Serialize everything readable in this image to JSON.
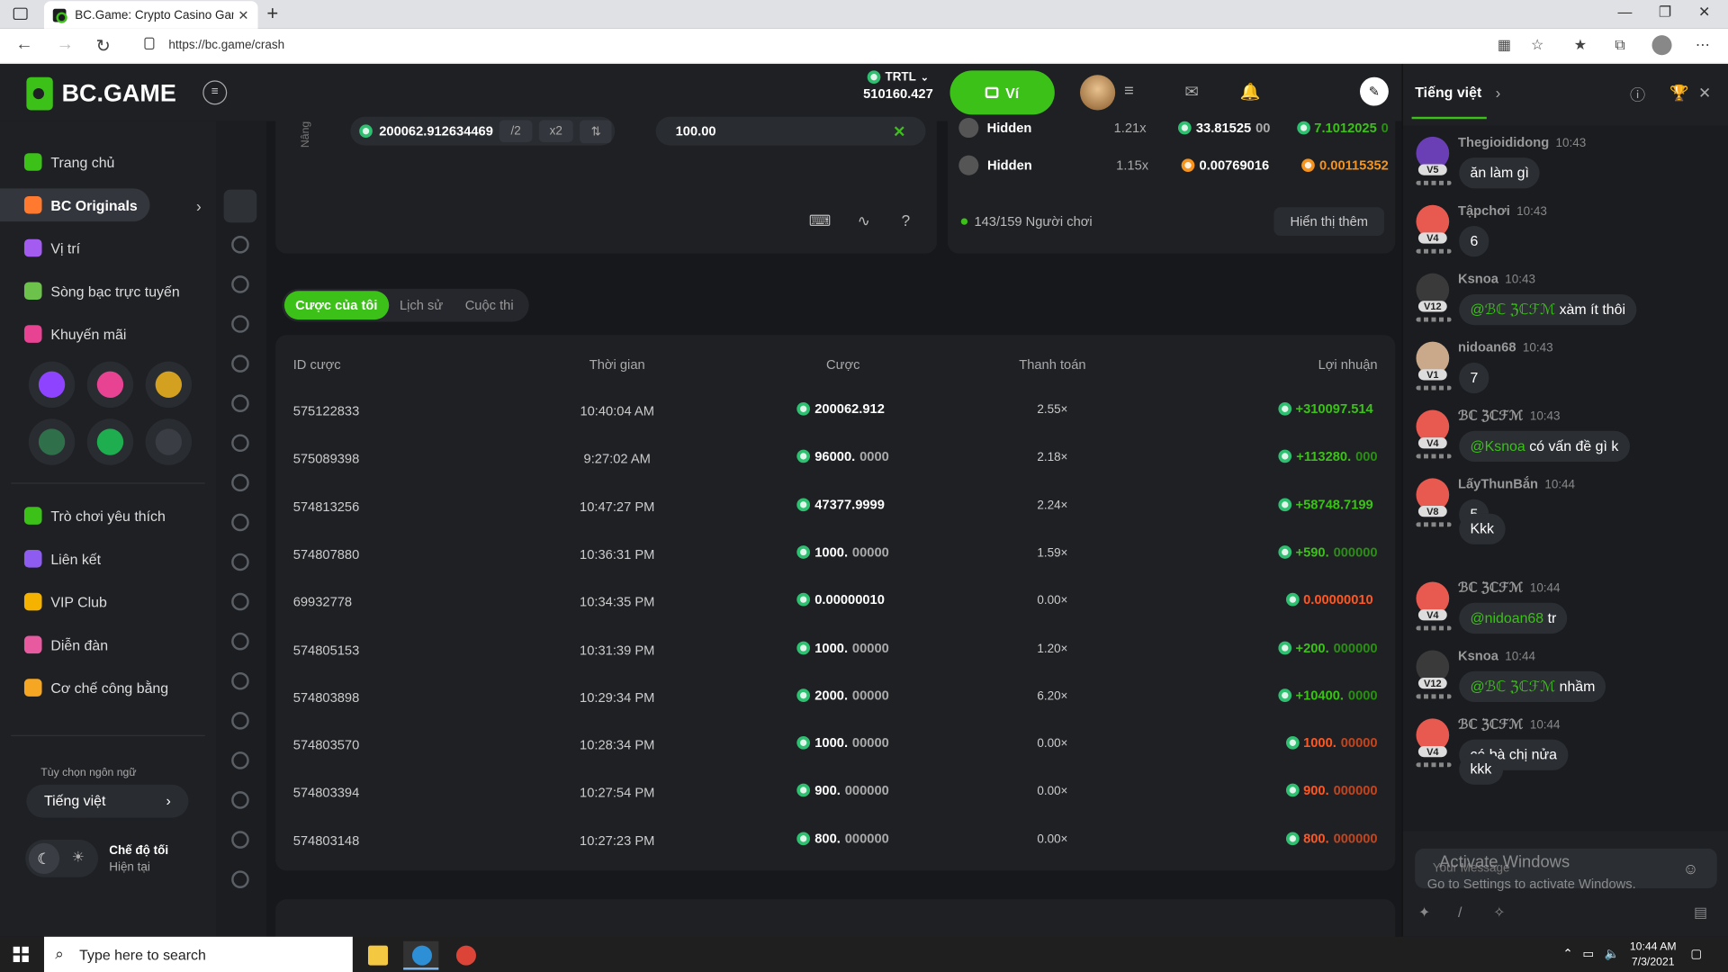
{
  "browser": {
    "tab_title": "BC.Game: Crypto Casino Games",
    "url": "https://bc.game/crash"
  },
  "header": {
    "logo": "BC.GAME",
    "currency": "TRTL",
    "balance": "510160.427",
    "wallet_label": "Ví"
  },
  "sidebar": {
    "items": [
      {
        "label": "Trang chủ",
        "color": "#3bc117"
      },
      {
        "label": "BC Originals",
        "color": "#ff7a2f"
      },
      {
        "label": "Vị trí",
        "color": "#a45cf0"
      },
      {
        "label": "Sòng bạc trực tuyến",
        "color": "#6cc24a"
      },
      {
        "label": "Khuyến mãi",
        "color": "#e84393"
      },
      {
        "label": "Trò chơi yêu thích",
        "color": "#3bc117"
      },
      {
        "label": "Liên kết",
        "color": "#8e5cf0"
      },
      {
        "label": "VIP Club",
        "color": "#f5b300"
      },
      {
        "label": "Diễn đàn",
        "color": "#e85aa0"
      },
      {
        "label": "Cơ chế công bằng",
        "color": "#f5a623"
      }
    ],
    "language_label": "Tùy chọn ngôn ngữ",
    "language_value": "Tiếng việt",
    "dark_mode_label": "Chế độ tối",
    "dark_mode_sub": "Hiện tại"
  },
  "game_panel": {
    "side_label": "Nâng",
    "amount": "200062.912634469",
    "half": "/2",
    "double": "x2",
    "cashout": "100.00"
  },
  "live_bets": {
    "rows": [
      {
        "name": "Hidden",
        "mult": "1.21x",
        "bet": "33.81525",
        "bet_dec": "00",
        "win": "7.1012025",
        "win_dec": "0"
      },
      {
        "name": "Hidden",
        "mult": "1.15x",
        "bet": "0.00769016",
        "win": "0.00115352"
      }
    ],
    "players": "143/159 Người chơi",
    "more": "Hiển thị thêm"
  },
  "bets_tabs": [
    "Cược của tôi",
    "Lịch sử",
    "Cuộc thi"
  ],
  "bets_table": {
    "headers": [
      "ID cược",
      "Thời gian",
      "Cược",
      "Thanh toán",
      "Lợi nhuận"
    ],
    "rows": [
      {
        "id": "575122833",
        "time": "10:40:04 AM",
        "bet": "200062.912",
        "bet_dec": "",
        "payout": "2.55×",
        "profit": "+310097.514",
        "profit_dec": "",
        "win": true
      },
      {
        "id": "575089398",
        "time": "9:27:02 AM",
        "bet": "96000.",
        "bet_dec": "0000",
        "payout": "2.18×",
        "profit": "+113280.",
        "profit_dec": "000",
        "win": true
      },
      {
        "id": "574813256",
        "time": "10:47:27 PM",
        "bet": "47377.9999",
        "bet_dec": "",
        "payout": "2.24×",
        "profit": "+58748.7199",
        "profit_dec": "",
        "win": true
      },
      {
        "id": "574807880",
        "time": "10:36:31 PM",
        "bet": "1000.",
        "bet_dec": "00000",
        "payout": "1.59×",
        "profit": "+590.",
        "profit_dec": "000000",
        "win": true
      },
      {
        "id": "69932778",
        "time": "10:34:35 PM",
        "bet": "0.00000010",
        "bet_dec": "",
        "payout": "0.00×",
        "profit": "0.00000010",
        "profit_dec": "",
        "win": false
      },
      {
        "id": "574805153",
        "time": "10:31:39 PM",
        "bet": "1000.",
        "bet_dec": "00000",
        "payout": "1.20×",
        "profit": "+200.",
        "profit_dec": "000000",
        "win": true
      },
      {
        "id": "574803898",
        "time": "10:29:34 PM",
        "bet": "2000.",
        "bet_dec": "00000",
        "payout": "6.20×",
        "profit": "+10400.",
        "profit_dec": "0000",
        "win": true
      },
      {
        "id": "574803570",
        "time": "10:28:34 PM",
        "bet": "1000.",
        "bet_dec": "00000",
        "payout": "0.00×",
        "profit": "1000.",
        "profit_dec": "00000",
        "win": false
      },
      {
        "id": "574803394",
        "time": "10:27:54 PM",
        "bet": "900.",
        "bet_dec": "000000",
        "payout": "0.00×",
        "profit": "900.",
        "profit_dec": "000000",
        "win": false
      },
      {
        "id": "574803148",
        "time": "10:27:23 PM",
        "bet": "800.",
        "bet_dec": "000000",
        "payout": "0.00×",
        "profit": "800.",
        "profit_dec": "000000",
        "win": false
      }
    ]
  },
  "chat": {
    "language": "Tiếng việt",
    "messages": [
      {
        "name": "Thegioididong",
        "time": "10:43",
        "level": "V5",
        "text": "ăn làm gì",
        "mention": "",
        "avatar": "#6a3fb5"
      },
      {
        "name": "Tậpchơi",
        "time": "10:43",
        "level": "V4",
        "text": "6",
        "mention": "",
        "avatar": "#e85a4f"
      },
      {
        "name": "Ksnoa",
        "time": "10:43",
        "level": "V12",
        "text": "xàm ít thôi",
        "mention": "@ℬℂ ℨℂℱℳ",
        "avatar": "#3a3a3a"
      },
      {
        "name": "nidoan68",
        "time": "10:43",
        "level": "V1",
        "text": "7",
        "mention": "",
        "avatar": "#c9a98a"
      },
      {
        "name": "ℬℂ ℨℂℱℳ",
        "time": "10:43",
        "level": "V4",
        "text": "có vấn đề gì k",
        "mention": "@Ksnoa",
        "avatar": "#e85a4f"
      },
      {
        "name": "LấyThunBắn",
        "time": "10:44",
        "level": "V8",
        "text": "5",
        "mention": "",
        "avatar": "#e85a4f"
      },
      {
        "name": "",
        "time": "",
        "level": "",
        "text": "Kkk",
        "mention": "",
        "avatar": ""
      },
      {
        "name": "ℬℂ ℨℂℱℳ",
        "time": "10:44",
        "level": "V4",
        "text": "tr",
        "mention": "@nidoan68",
        "avatar": "#e85a4f"
      },
      {
        "name": "Ksnoa",
        "time": "10:44",
        "level": "V12",
        "text": "nhầm",
        "mention": "@ℬℂ ℨℂℱℳ",
        "avatar": "#3a3a3a"
      },
      {
        "name": "ℬℂ ℨℂℱℳ",
        "time": "10:44",
        "level": "V4",
        "text": "có bà chị nửa",
        "mention": "",
        "avatar": "#e85a4f"
      },
      {
        "name": "",
        "time": "",
        "level": "",
        "text": "kkk",
        "mention": "",
        "avatar": ""
      }
    ],
    "placeholder": "Your Message",
    "watermark_title": "Activate Windows",
    "watermark_sub": "Go to Settings to activate Windows."
  },
  "taskbar": {
    "search": "Type here to search",
    "time": "10:44 AM",
    "date": "7/3/2021"
  }
}
